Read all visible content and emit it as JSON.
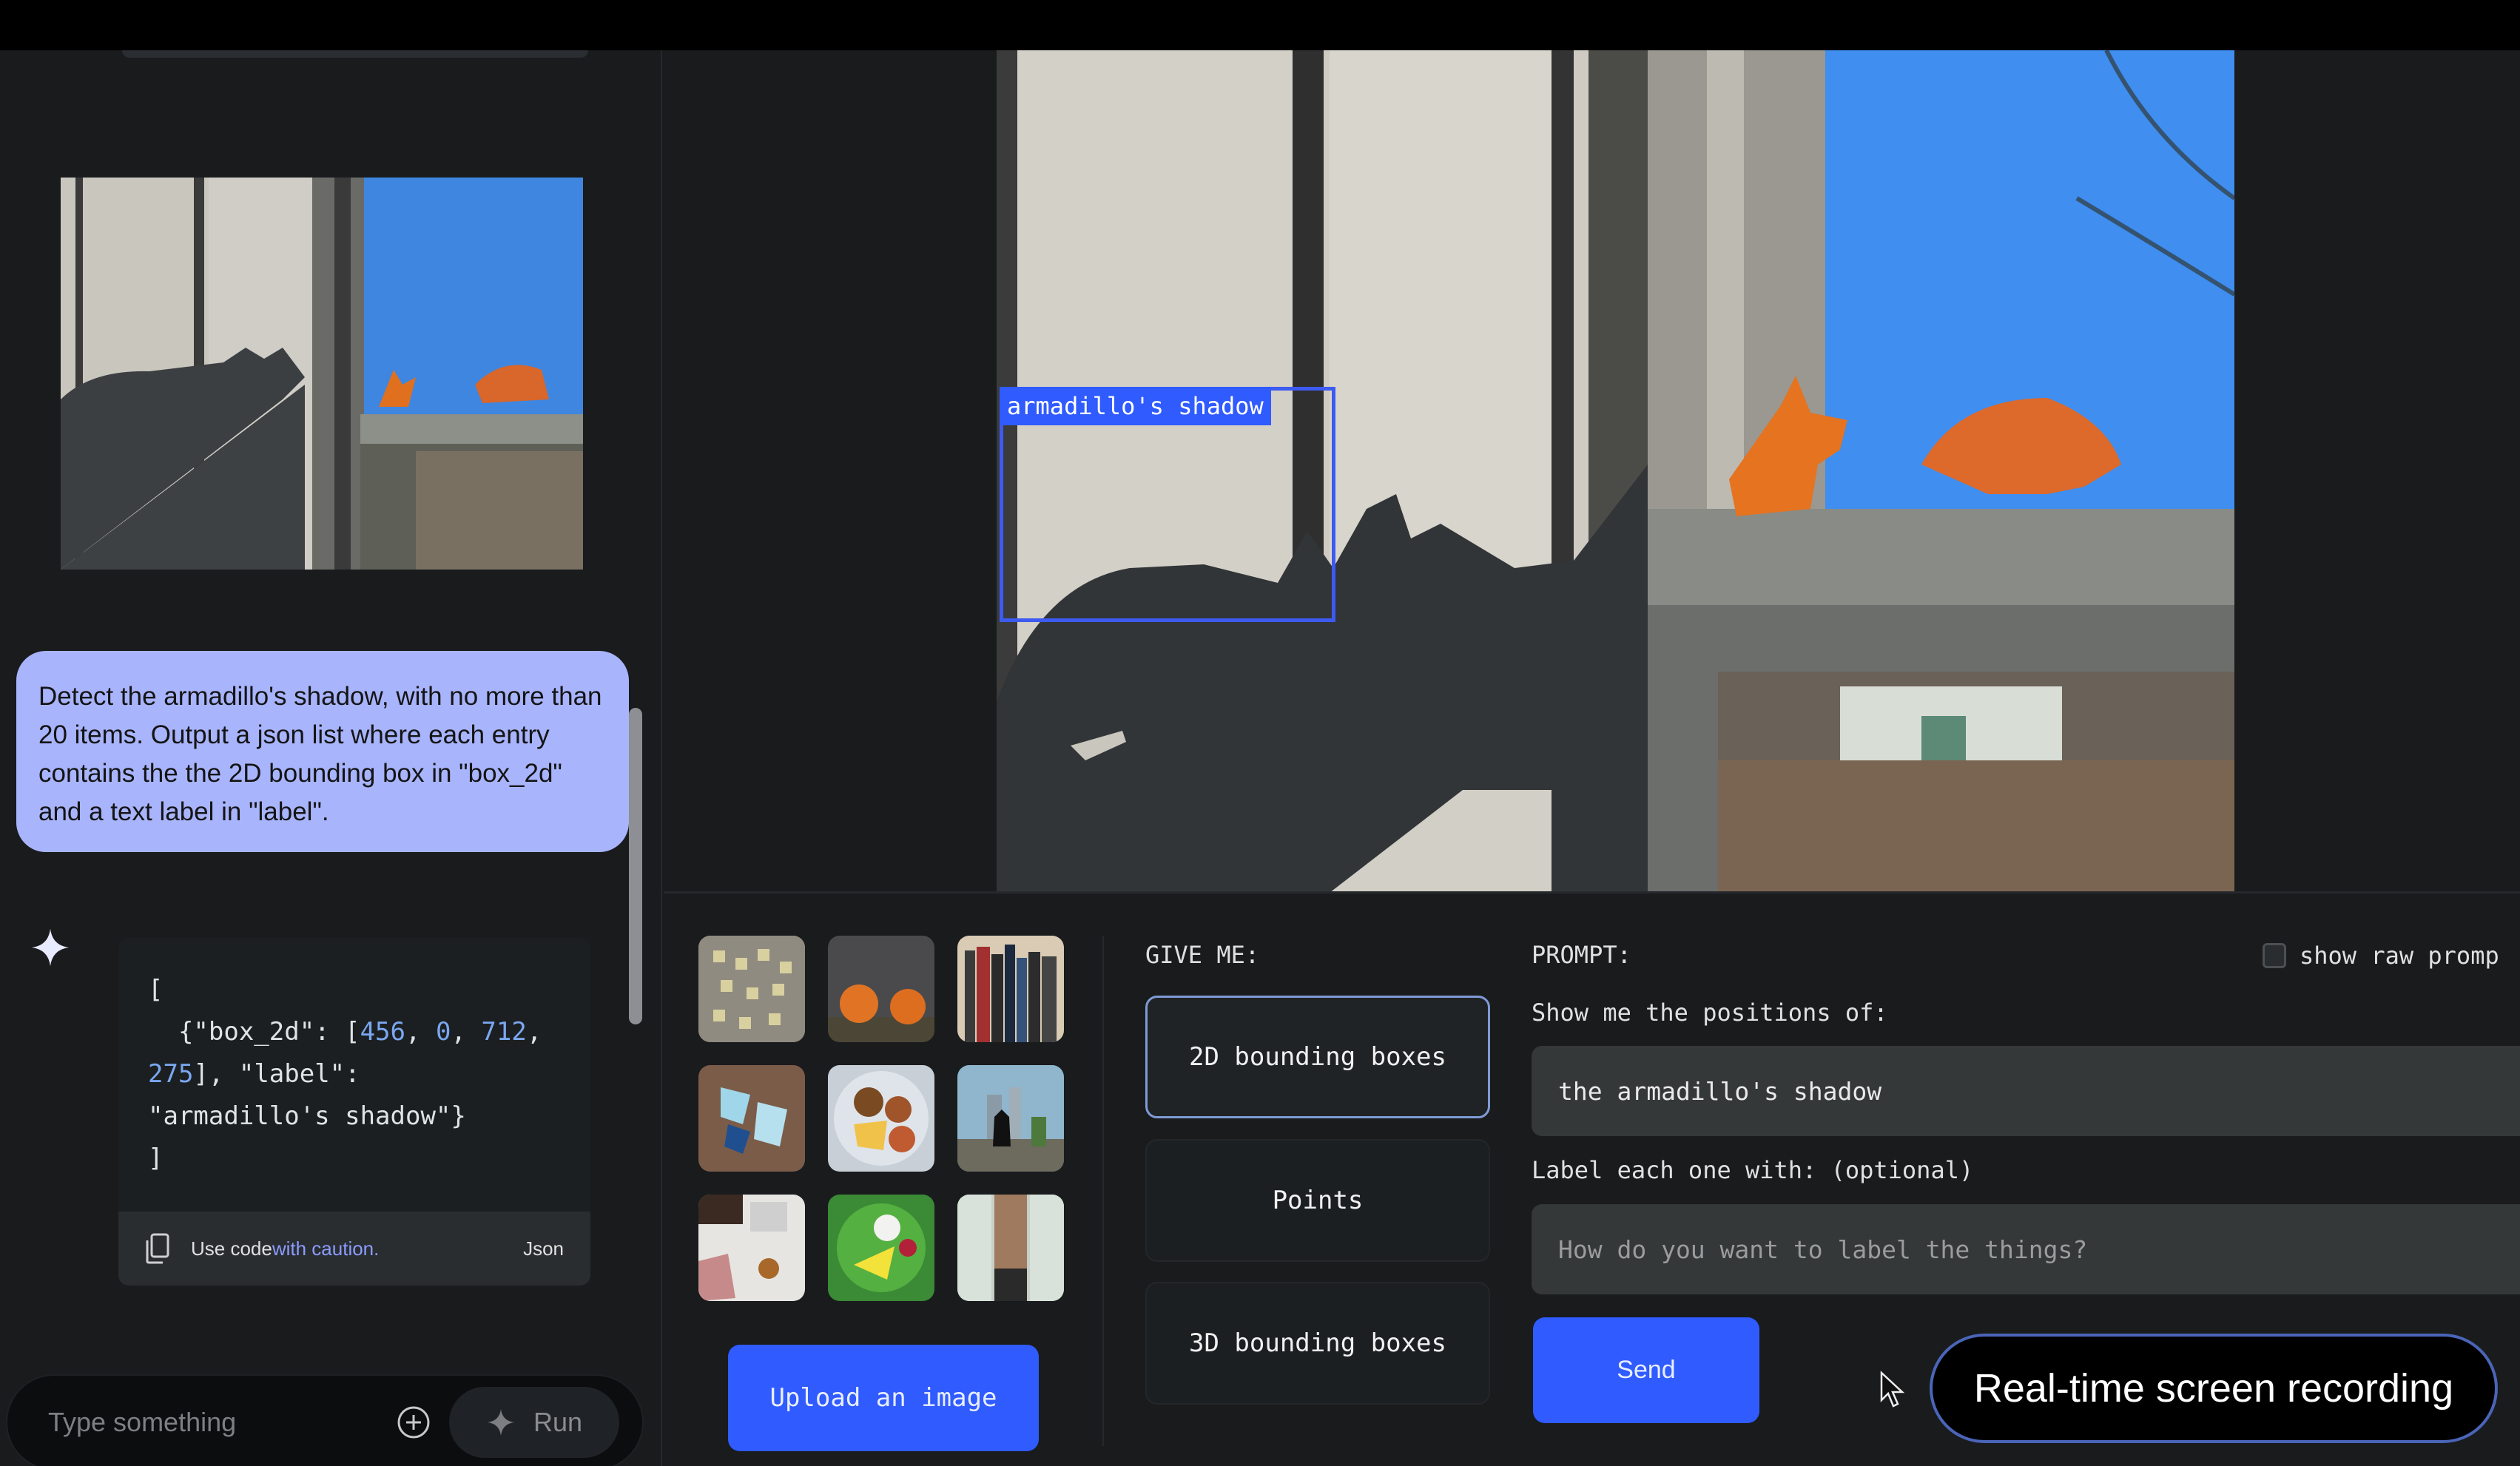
{
  "colors": {
    "accent_blue": "#2f5bff",
    "bubble_lavender": "#a8b4fc",
    "panel_bg": "#191b1d",
    "bbox_blue": "#3d5af1"
  },
  "chat": {
    "attached_image": {
      "icon": "photo-thumbnail",
      "description": "window with origami fox and armadillo on sill and their shadows"
    },
    "user_message": "Detect the armadillo's shadow, with no more than 20 items. Output a json list where each entry contains the the 2D bounding box in \"box_2d\" and a text label in \"label\".",
    "model_icon": "sparkle-icon",
    "response_code": {
      "line1": "[",
      "line2_prefix": "  {\"box_2d\": [",
      "box_values": [
        "456",
        "0",
        "712",
        "275"
      ],
      "label_key": "\"label\":",
      "label_value": "\"armadillo's shadow\"}",
      "line_end": "]"
    },
    "code_footer": {
      "copy_icon": "copy-icon",
      "use_code": "Use code ",
      "caution_link": "with caution.",
      "language": "Json"
    },
    "input": {
      "placeholder": "Type something",
      "add_icon": "plus-circle-icon",
      "run_label": "Run",
      "run_icon": "sparkle-icon"
    }
  },
  "detection": {
    "label": "armadillo's shadow",
    "box_2d": [
      456,
      0,
      712,
      275
    ]
  },
  "samples": [
    {
      "name": "sticky-notes"
    },
    {
      "name": "pumpkins"
    },
    {
      "name": "books"
    },
    {
      "name": "socks"
    },
    {
      "name": "breakfast-plate"
    },
    {
      "name": "cat-window"
    },
    {
      "name": "spill-table"
    },
    {
      "name": "cheese-plate"
    },
    {
      "name": "office-window"
    }
  ],
  "upload_label": "Upload an image",
  "give_me": {
    "label": "GIVE ME:",
    "options": [
      "2D bounding boxes",
      "Points",
      "3D bounding boxes"
    ],
    "selected": "2D bounding boxes"
  },
  "prompt": {
    "label": "PROMPT:",
    "show_raw_label": "show raw promp",
    "show_raw_checked": false,
    "positions_label": "Show me the positions of:",
    "positions_value": "the armadillo's shadow",
    "label_each_label": "Label each one with: (optional)",
    "label_each_placeholder": "How do you want to label the things?",
    "send_label": "Send"
  },
  "overlay": {
    "recording_label": "Real-time screen recording"
  }
}
